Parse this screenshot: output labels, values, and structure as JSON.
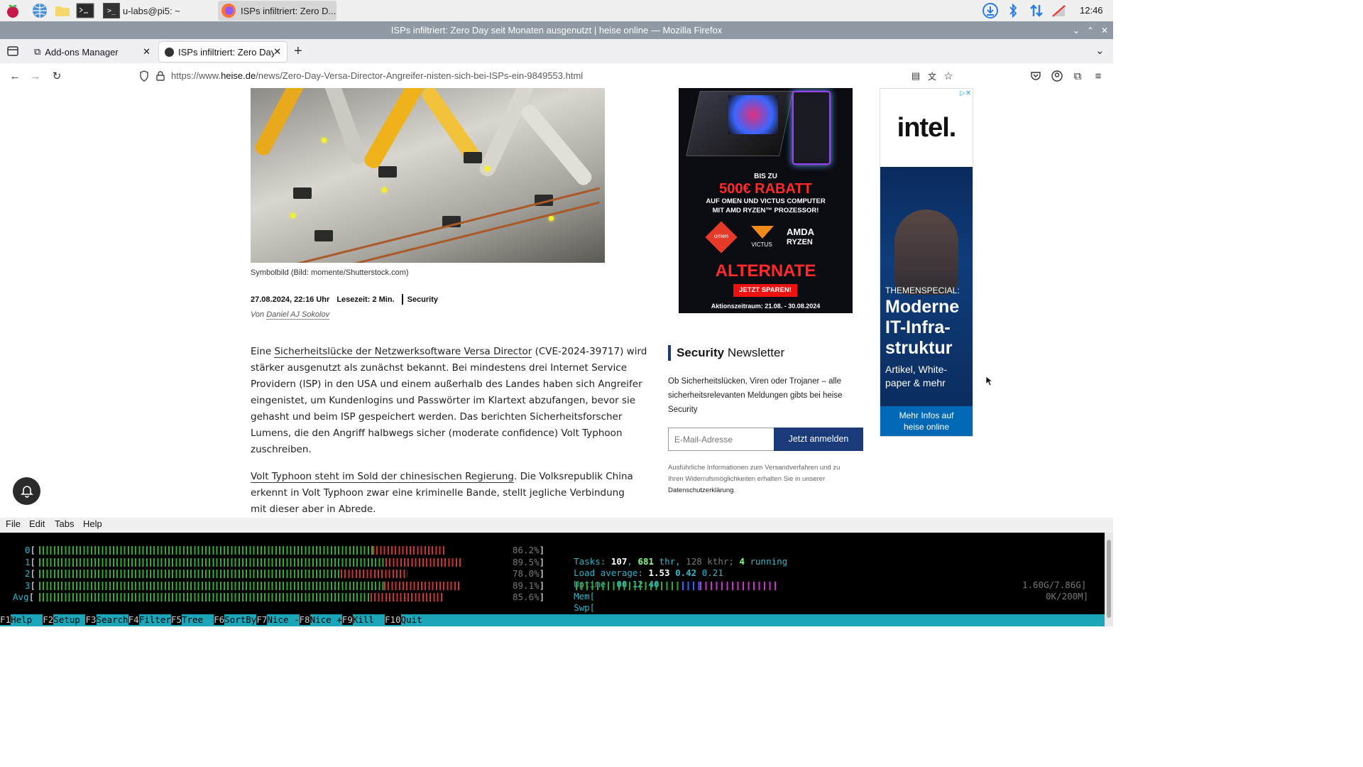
{
  "taskbar": {
    "tasks": [
      {
        "label": "u-labs@pi5: ~"
      },
      {
        "label": "ISPs infiltriert: Zero D..."
      }
    ],
    "clock": "12:46"
  },
  "window": {
    "title": "ISPs infiltriert: Zero Day seit Monaten ausgenutzt | heise online — Mozilla Firefox"
  },
  "tabs": [
    {
      "label": "Add-ons Manager"
    },
    {
      "label": "ISPs infiltriert: Zero Day"
    }
  ],
  "nav": {
    "url_prefix": "https://www.",
    "url_domain": "heise.de",
    "url_path": "/news/Zero-Day-Versa-Director-Angreifer-nisten-sich-bei-ISPs-ein-9849553.html"
  },
  "article": {
    "caption": "Symbolbild (Bild: momente/Shutterstock.com)",
    "date": "27.08.2024, 22:16 Uhr",
    "readtime": "Lesezeit: 2 Min.",
    "category": "Security",
    "author_prefix": "Von ",
    "author": "Daniel AJ Sokolov",
    "p1_start": "Eine ",
    "p1_link": "Sicherheitslücke der Netzwerksoftware Versa Director",
    "p1_line1_end": " (CVE-2024-39717) wird",
    "p1_lines": [
      "stärker ausgenutzt als zunächst bekannt. Bei mindestens drei Internet Service",
      "Providern (ISP) in den USA und einem außerhalb des Landes haben sich Angreifer",
      "eingenistet, um Kundenlogins und Passwörter im Klartext abzufangen, bevor sie",
      "gehasht und beim ISP gespeichert werden. Das berichten Sicherheitsforscher",
      "Lumens, die den Angriff halbwegs sicher (moderate confidence) Volt Typhoon",
      "zuschreiben."
    ],
    "p2_link": "Volt Typhoon steht im Sold der chinesischen Regierung",
    "p2_line1_end": ". Die Volksrepublik China",
    "p2_lines": [
      "erkennt in Volt Typhoon zwar eine kriminelle Bande, stellt jegliche Verbindung",
      "mit dieser aber in Abrede."
    ]
  },
  "ad_alternate": {
    "l1": "BIS ZU",
    "l2": "500€ RABATT",
    "l3": "AUF OMEN UND VICTUS COMPUTER",
    "l4": "MIT AMD RYZEN™ PROZESSOR!",
    "omen": "omen",
    "victus": "VICTUS",
    "amd": "AMDA",
    "ryzen": "RYZEN",
    "brand": "ALTERNATE",
    "cta": "JETZT SPAREN!",
    "period": "Aktionszeitraum: 21.08. - 30.08.2024"
  },
  "newsletter": {
    "title_bold": "Security",
    "title_rest": " Newsletter",
    "desc": [
      "Ob Sicherheitslücken, Viren oder Trojaner – alle",
      "sicherheitsrelevanten Meldungen gibts bei heise",
      "Security"
    ],
    "email_placeholder": "E-Mail-Adresse",
    "submit": "Jetzt anmelden",
    "fine1": "Ausführliche Informationen zum Versandverfahren und zu",
    "fine2": "Ihren Widerrufsmöglichkeiten erhalten Sie in unserer",
    "fine_link": "Datenschutzerklärung",
    "fine_end": "."
  },
  "ad_intel": {
    "logo": "intel.",
    "kicker": "THEMENSPECIAL:",
    "h1": "Moderne",
    "h2": "IT-Infra-",
    "h3": "struktur",
    "s1": "Artikel, White-",
    "s2": "paper & mehr",
    "cta1": "Mehr Infos auf",
    "cta2": "heise online"
  },
  "terminal": {
    "menu": [
      "File",
      "Edit",
      "Tabs",
      "Help"
    ],
    "cpus": [
      {
        "label": "0",
        "pct": "86.2%",
        "value": 86.2
      },
      {
        "label": "1",
        "pct": "89.5%",
        "value": 89.5
      },
      {
        "label": "2",
        "pct": "78.0%",
        "value": 78.0
      },
      {
        "label": "3",
        "pct": "89.1%",
        "value": 89.1
      },
      {
        "label": "Avg",
        "pct": "85.6%",
        "value": 85.6
      }
    ],
    "tasks_label": "Tasks: ",
    "tasks": "107",
    "thr": "681",
    "thr_label": " thr, ",
    "kthr": "128 kthr; ",
    "running": "4",
    "running_label": " running",
    "load_label": "Load average: ",
    "load1": "1.53",
    "load5": "0.42",
    "load15": "0.21",
    "uptime_label": "Uptime: ",
    "uptime": "00:12:40",
    "mem_label": "Mem[",
    "mem_value": "1.60G/7.86G]",
    "swp_label": "Swp[",
    "swp_value": "0K/200M]",
    "fkeys": [
      {
        "k": "F1",
        "l": "Help  "
      },
      {
        "k": "F2",
        "l": "Setup "
      },
      {
        "k": "F3",
        "l": "Search"
      },
      {
        "k": "F4",
        "l": "Filter"
      },
      {
        "k": "F5",
        "l": "Tree  "
      },
      {
        "k": "F6",
        "l": "SortBy"
      },
      {
        "k": "F7",
        "l": "Nice -"
      },
      {
        "k": "F8",
        "l": "Nice +"
      },
      {
        "k": "F9",
        "l": "Kill  "
      },
      {
        "k": "F10",
        "l": "Quit  "
      }
    ]
  }
}
